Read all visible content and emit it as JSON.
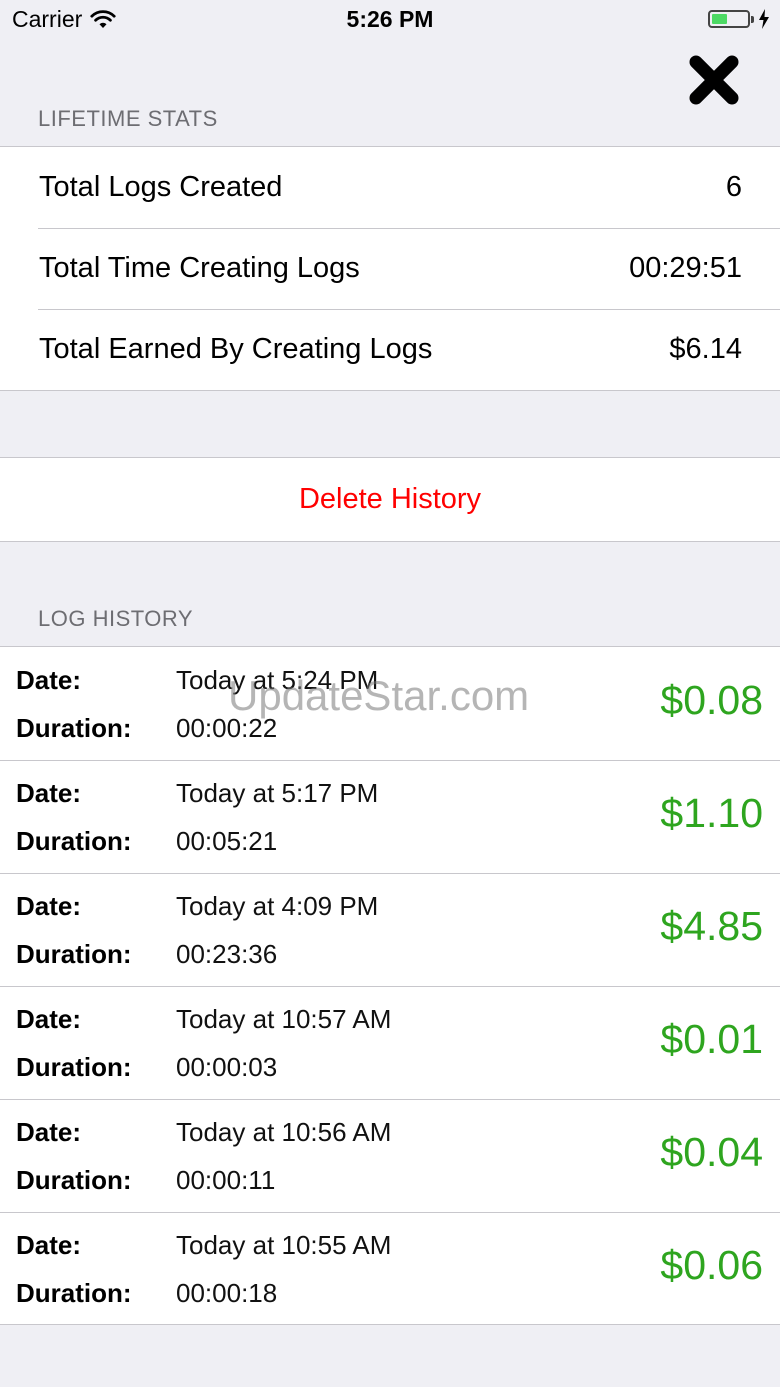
{
  "status_bar": {
    "carrier": "Carrier",
    "time": "5:26 PM",
    "battery_color": "#4cd964"
  },
  "lifetime_stats": {
    "header": "LIFETIME STATS",
    "rows": [
      {
        "label": "Total Logs Created",
        "value": "6"
      },
      {
        "label": "Total Time Creating Logs",
        "value": "00:29:51"
      },
      {
        "label": "Total Earned By Creating Logs",
        "value": "$6.14"
      }
    ]
  },
  "actions": {
    "delete_label": "Delete History",
    "delete_color": "#ff0000"
  },
  "log_history": {
    "header": "LOG HISTORY",
    "date_label": "Date:",
    "duration_label": "Duration:",
    "amount_color": "#2ea51f",
    "items": [
      {
        "date": "Today at 5:24 PM",
        "duration": "00:00:22",
        "amount": "$0.08"
      },
      {
        "date": "Today at 5:17 PM",
        "duration": "00:05:21",
        "amount": "$1.10"
      },
      {
        "date": "Today at 4:09 PM",
        "duration": "00:23:36",
        "amount": "$4.85"
      },
      {
        "date": "Today at 10:57 AM",
        "duration": "00:00:03",
        "amount": "$0.01"
      },
      {
        "date": "Today at 10:56 AM",
        "duration": "00:00:11",
        "amount": "$0.04"
      },
      {
        "date": "Today at 10:55 AM",
        "duration": "00:00:18",
        "amount": "$0.06"
      }
    ]
  },
  "watermark": "UpdateStar.com"
}
